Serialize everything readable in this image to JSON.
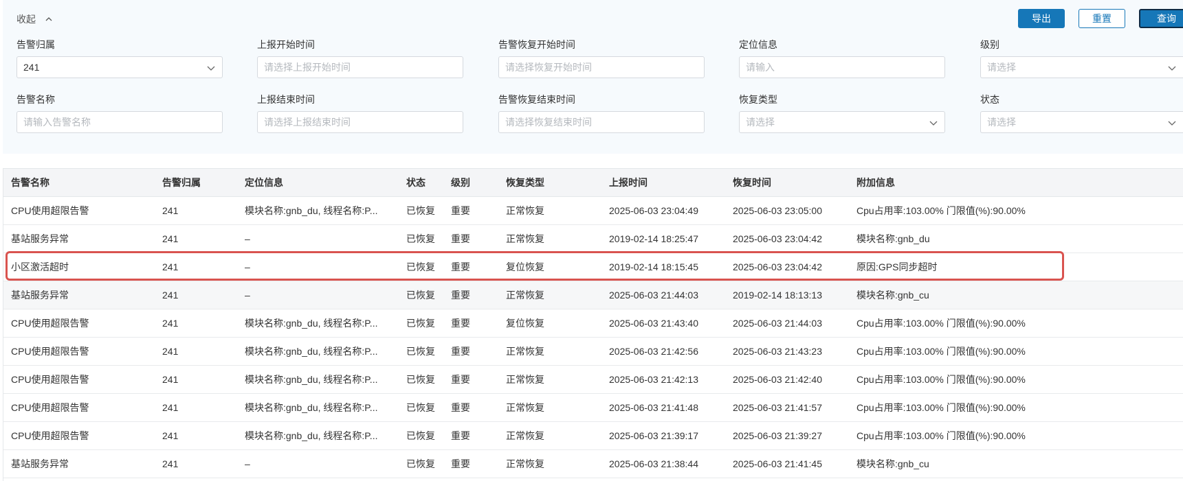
{
  "filters": {
    "collapse_label": "收起",
    "export_label": "导出",
    "reset_label": "重置",
    "query_label": "查询",
    "alarm_owner": {
      "label": "告警归属",
      "value": "241"
    },
    "report_start": {
      "label": "上报开始时间",
      "placeholder": "请选择上报开始时间"
    },
    "recover_start": {
      "label": "告警恢复开始时间",
      "placeholder": "请选择恢复开始时间"
    },
    "location": {
      "label": "定位信息",
      "placeholder": "请输入"
    },
    "level": {
      "label": "级别",
      "placeholder": "请选择"
    },
    "alarm_name": {
      "label": "告警名称",
      "placeholder": "请输入告警名称"
    },
    "report_end": {
      "label": "上报结束时间",
      "placeholder": "请选择上报结束时间"
    },
    "recover_end": {
      "label": "告警恢复结束时间",
      "placeholder": "请选择恢复结束时间"
    },
    "recover_type": {
      "label": "恢复类型",
      "placeholder": "请选择"
    },
    "status": {
      "label": "状态",
      "placeholder": "请选择"
    }
  },
  "table": {
    "columns": [
      "告警名称",
      "告警归属",
      "定位信息",
      "状态",
      "级别",
      "恢复类型",
      "上报时间",
      "恢复时间",
      "附加信息"
    ],
    "rows": [
      [
        "CPU使用超限告警",
        "241",
        "模块名称:gnb_du, 线程名称:P...",
        "已恢复",
        "重要",
        "正常恢复",
        "2025-06-03 23:04:49",
        "2025-06-03 23:05:00",
        "Cpu占用率:103.00% 门限值(%):90.00%"
      ],
      [
        "基站服务异常",
        "241",
        "–",
        "已恢复",
        "重要",
        "正常恢复",
        "2019-02-14 18:25:47",
        "2025-06-03 23:04:42",
        "模块名称:gnb_du"
      ],
      [
        "小区激活超时",
        "241",
        "–",
        "已恢复",
        "重要",
        "复位恢复",
        "2019-02-14 18:15:45",
        "2025-06-03 23:04:42",
        "原因:GPS同步超时"
      ],
      [
        "基站服务异常",
        "241",
        "–",
        "已恢复",
        "重要",
        "正常恢复",
        "2025-06-03 21:44:03",
        "2019-02-14 18:13:13",
        "模块名称:gnb_cu"
      ],
      [
        "CPU使用超限告警",
        "241",
        "模块名称:gnb_du, 线程名称:P...",
        "已恢复",
        "重要",
        "复位恢复",
        "2025-06-03 21:43:40",
        "2025-06-03 21:44:03",
        "Cpu占用率:103.00% 门限值(%):90.00%"
      ],
      [
        "CPU使用超限告警",
        "241",
        "模块名称:gnb_du, 线程名称:P...",
        "已恢复",
        "重要",
        "正常恢复",
        "2025-06-03 21:42:56",
        "2025-06-03 21:43:23",
        "Cpu占用率:103.00% 门限值(%):90.00%"
      ],
      [
        "CPU使用超限告警",
        "241",
        "模块名称:gnb_du, 线程名称:P...",
        "已恢复",
        "重要",
        "正常恢复",
        "2025-06-03 21:42:13",
        "2025-06-03 21:42:40",
        "Cpu占用率:103.00% 门限值(%):90.00%"
      ],
      [
        "CPU使用超限告警",
        "241",
        "模块名称:gnb_du, 线程名称:P...",
        "已恢复",
        "重要",
        "正常恢复",
        "2025-06-03 21:41:48",
        "2025-06-03 21:41:57",
        "Cpu占用率:103.00% 门限值(%):90.00%"
      ],
      [
        "CPU使用超限告警",
        "241",
        "模块名称:gnb_du, 线程名称:P...",
        "已恢复",
        "重要",
        "正常恢复",
        "2025-06-03 21:39:17",
        "2025-06-03 21:39:27",
        "Cpu占用率:103.00% 门限值(%):90.00%"
      ],
      [
        "基站服务异常",
        "241",
        "–",
        "已恢复",
        "重要",
        "正常恢复",
        "2025-06-03 21:38:44",
        "2025-06-03 21:41:45",
        "模块名称:gnb_cu"
      ]
    ]
  },
  "colors": {
    "primary": "#1677b8",
    "highlight": "#d9534f",
    "panel_bg": "#f6fafd"
  },
  "icons": {
    "collapse": "chevron-up-icon",
    "dropdown": "chevron-down-icon"
  }
}
